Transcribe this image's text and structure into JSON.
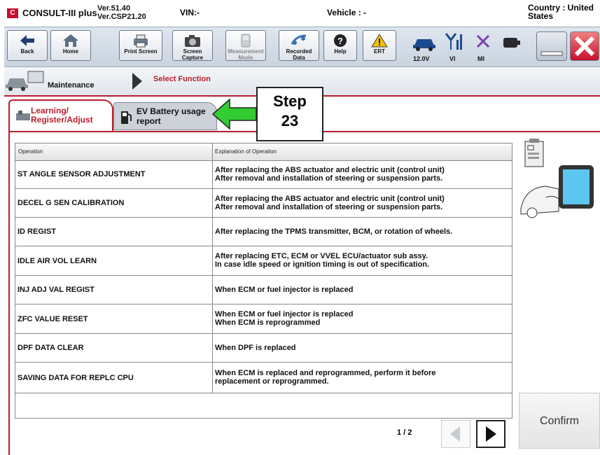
{
  "header": {
    "logo": "C",
    "app_name": "CONSULT-III plus",
    "version_line1": "Ver.51.40",
    "version_line2": "Ver.CSP21.20",
    "vin_label": "VIN:-",
    "vehicle_label": "Vehicle : -",
    "country_line1": "Country : United",
    "country_line2": "States"
  },
  "toolbar": {
    "back": "Back",
    "home": "Home",
    "print_screen": "Print Screen",
    "screen_capture_1": "Screen",
    "screen_capture_2": "Capture",
    "measurement_1": "Measurement",
    "measurement_2": "Mode",
    "recorded_1": "Recorded",
    "recorded_2": "Data",
    "help": "Help",
    "ert": "ERT",
    "voltage": "12.0V",
    "vi": "VI",
    "mi": "MI"
  },
  "breadcrumb": {
    "maintenance": "Maintenance",
    "select_function": "Select Function"
  },
  "tabs": {
    "tab1_line1": "Learning/",
    "tab1_line2": "Register/Adjust",
    "tab2_line1": "EV Battery usage",
    "tab2_line2": "report"
  },
  "callout": {
    "line1": "Step",
    "line2": "23"
  },
  "table": {
    "col_operation": "Operation",
    "col_explanation": "Explanation of Operation",
    "rows": [
      {
        "op": "ST ANGLE SENSOR ADJUSTMENT",
        "exp1": "After replacing the ABS actuator and electric unit (control unit)",
        "exp2": "After removal and installation of steering or suspension parts."
      },
      {
        "op": "DECEL G SEN CALIBRATION",
        "exp1": "After replacing the ABS actuator and electric unit (control unit)",
        "exp2": "After removal and installation of steering or suspension parts."
      },
      {
        "op": "ID REGIST",
        "exp1": "After replacing the TPMS transmitter, BCM, or rotation of wheels.",
        "exp2": ""
      },
      {
        "op": "IDLE AIR VOL LEARN",
        "exp1": "After replacing ETC, ECM or VVEL ECU/actuator sub assy.",
        "exp2": "In case idle speed or ignition timing is out of specification."
      },
      {
        "op": "INJ ADJ VAL REGIST",
        "exp1": "When ECM or fuel injector is replaced",
        "exp2": ""
      },
      {
        "op": "ZFC VALUE RESET",
        "exp1": "When ECM or fuel injector is replaced",
        "exp2": "When ECM is reprogrammed"
      },
      {
        "op": "DPF DATA CLEAR",
        "exp1": "When DPF is replaced",
        "exp2": ""
      },
      {
        "op": "SAVING DATA FOR REPLC CPU",
        "exp1": "When ECM is replaced and reprogrammed, perform it before",
        "exp2": "replacement or reprogrammed."
      }
    ]
  },
  "pager": {
    "page": "1 / 2"
  },
  "confirm_label": "Confirm"
}
